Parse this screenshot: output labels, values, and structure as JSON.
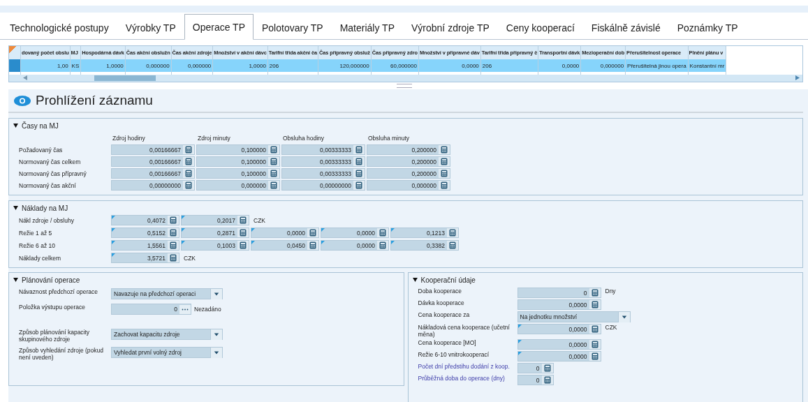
{
  "tabs": [
    {
      "label": "Technologické postupy",
      "selected": false
    },
    {
      "label": "Výrobky TP",
      "selected": false
    },
    {
      "label": "Operace TP",
      "selected": true
    },
    {
      "label": "Polotovary TP",
      "selected": false
    },
    {
      "label": "Materiály TP",
      "selected": false
    },
    {
      "label": "Výrobní zdroje TP",
      "selected": false
    },
    {
      "label": "Ceny kooperací",
      "selected": false
    },
    {
      "label": "Fiskálně závislé",
      "selected": false
    },
    {
      "label": "Poznámky TP",
      "selected": false
    }
  ],
  "grid": {
    "columns": [
      {
        "label": "dovaný počet obslu",
        "kind": "number"
      },
      {
        "label": "MJ",
        "kind": "text"
      },
      {
        "label": "Hospodárná dávk",
        "kind": "number"
      },
      {
        "label": "Čas akční obslužn",
        "kind": "number"
      },
      {
        "label": "Čas akční zdroje",
        "kind": "number"
      },
      {
        "label": "Množství v akční dávc",
        "kind": "number"
      },
      {
        "label": "Tarifní třída akční ča",
        "kind": "text"
      },
      {
        "label": "Čas přípravný obsluž",
        "kind": "number"
      },
      {
        "label": "Čas přípravný zdro",
        "kind": "number"
      },
      {
        "label": "Množství v přípravné dáv",
        "kind": "number"
      },
      {
        "label": "Tarifní třída přípravný č",
        "kind": "text"
      },
      {
        "label": "Transportní dávk",
        "kind": "number"
      },
      {
        "label": "Mezioperační dob",
        "kind": "number"
      },
      {
        "label": "Přerušitelnost operace",
        "kind": "text"
      },
      {
        "label": "Plnění plánu v",
        "kind": "text"
      }
    ],
    "rows": [
      {
        "selected": true,
        "cells": [
          "1,00",
          "KS",
          "1,0000",
          "0,000000",
          "0,000000",
          "1,0000",
          "206",
          "120,000000",
          "60,000000",
          "0,0000",
          "206",
          "0,0000",
          "0,000000",
          "Přerušitelná jinou opera",
          "Konstantní mr"
        ]
      }
    ]
  },
  "form": {
    "title": "Prohlížení záznamu",
    "times": {
      "title": "Časy na MJ",
      "expanded": true,
      "columns": [
        "Zdroj hodiny",
        "Zdroj minuty",
        "Obsluha hodiny",
        "Obsluha minuty"
      ],
      "rows": [
        {
          "label": "Požadovaný čas",
          "values": [
            "0,00166667",
            "0,100000",
            "0,00333333",
            "0,200000"
          ]
        },
        {
          "label": "Normovaný čas celkem",
          "values": [
            "0,00166667",
            "0,100000",
            "0,00333333",
            "0,200000"
          ]
        },
        {
          "label": "Normovaný čas přípravný",
          "values": [
            "0,00166667",
            "0,100000",
            "0,00333333",
            "0,200000"
          ]
        },
        {
          "label": "Normovaný čas akční",
          "values": [
            "0,00000000",
            "0,000000",
            "0,00000000",
            "0,000000"
          ]
        }
      ]
    },
    "costs": {
      "title": "Náklady na MJ",
      "expanded": true,
      "rows": [
        {
          "label": "Nákl zdroje / obsluhy",
          "marked": true,
          "values": [
            "0,4072",
            "0,2017"
          ],
          "unit": "CZK"
        },
        {
          "label": "Režie 1 až 5",
          "marked": true,
          "values": [
            "0,5152",
            "0,2871",
            "0,0000",
            "0,0000",
            "0,1213"
          ]
        },
        {
          "label": "Režie 6 až 10",
          "marked": true,
          "values": [
            "1,5561",
            "0,1003",
            "0,0450",
            "0,0000",
            "0,3382"
          ]
        },
        {
          "label": "Náklady celkem",
          "marked": true,
          "values": [
            "3,5721"
          ],
          "unit": "CZK"
        }
      ]
    },
    "planning": {
      "title": "Plánování operace",
      "expanded": true,
      "fields": [
        {
          "kind": "dropdown",
          "label": "Návaznost předchozí operace",
          "value": "Navazuje na předchozí operaci"
        },
        {
          "kind": "lookup",
          "label": "Položka výstupu operace",
          "value": "0",
          "note": "Nezadáno"
        },
        {
          "kind": "dropdown",
          "label": "Způsob plánování kapacity skupinového zdroje",
          "value": "Zachovat kapacitu zdroje"
        },
        {
          "kind": "dropdown",
          "label": "Způsob vyhledání zdroje  (pokud není uveden)",
          "value": "Vyhledat první volný zdroj"
        }
      ]
    },
    "cooperation": {
      "title": "Kooperační údaje",
      "expanded": true,
      "fields": [
        {
          "kind": "number",
          "label": "Doba kooperace",
          "value": "0",
          "unit": "Dny",
          "marked": false,
          "highlighted": false
        },
        {
          "kind": "number",
          "label": "Dávka kooperace",
          "value": "0,0000",
          "marked": false,
          "highlighted": false
        },
        {
          "kind": "dropdown",
          "label": "Cena kooperace za",
          "value": "Na jednotku množství",
          "highlighted": false
        },
        {
          "kind": "number",
          "label": "Nákladová cena kooperace (učetní měna)",
          "value": "0,0000",
          "unit": "CZK",
          "marked": true,
          "highlighted": false
        },
        {
          "kind": "number",
          "label": "Cena kooperace [MO]",
          "value": "0,0000",
          "marked": true,
          "highlighted": false
        },
        {
          "kind": "number",
          "label": "Režie 6-10 vnitrokooperací",
          "value": "0,0000",
          "marked": true,
          "highlighted": false
        },
        {
          "kind": "short",
          "label": "Počet dní předstihu dodání z koop.",
          "value": "0",
          "marked": false,
          "highlighted": true
        },
        {
          "kind": "short",
          "label": "Průběžná doba do operace (dny)",
          "value": "0",
          "marked": false,
          "highlighted": true
        }
      ]
    }
  }
}
